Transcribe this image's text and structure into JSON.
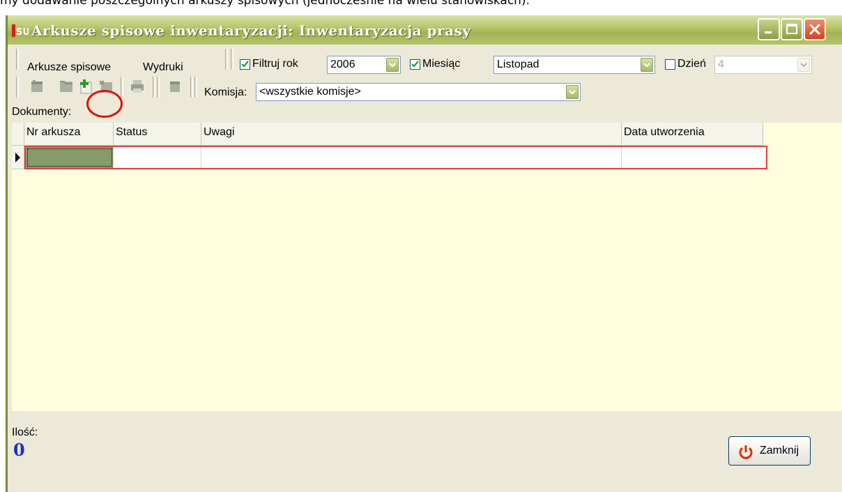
{
  "caption": "my dodawanie poszczególnych arkuszy spisowych (jednocześnie na wielu stanowiskach).",
  "window": {
    "title": "Arkusze spisowe inwentaryzacji: Inwentaryzacja prasy",
    "icon_text": "SU"
  },
  "menu": {
    "items": [
      "Arkusze spisowe",
      "Wydruki"
    ]
  },
  "filters": {
    "year": {
      "label": "Filtruj rok",
      "checked": true,
      "value": "2006"
    },
    "month": {
      "label": "Miesiąc",
      "checked": true,
      "value": "Listopad"
    },
    "day": {
      "label": "Dzień",
      "checked": false,
      "value": "4"
    }
  },
  "toolbar": {
    "icons": [
      "edit-sheet-icon",
      "open-sheet-icon",
      "add-sheet-icon",
      "delete-sheet-icon",
      "print-icon",
      "close-sheet-icon"
    ],
    "commission_label": "Komisja:",
    "commission_value": "<wszystkie komisje>"
  },
  "documents": {
    "label": "Dokumenty:",
    "columns": [
      "Nr arkusza",
      "Status",
      "Uwagi",
      "Data utworzenia"
    ],
    "rows": [
      [
        "",
        "",
        "",
        ""
      ]
    ]
  },
  "footer": {
    "count_label": "Ilość:",
    "count_value": "0",
    "close_button": "Zamknij"
  },
  "colors": {
    "titlebar": "#a3b155",
    "grid_background": "#ffffe0",
    "count_value": "#1a30c8",
    "selected_cell": "#869a6a",
    "highlight": "#e01010"
  }
}
